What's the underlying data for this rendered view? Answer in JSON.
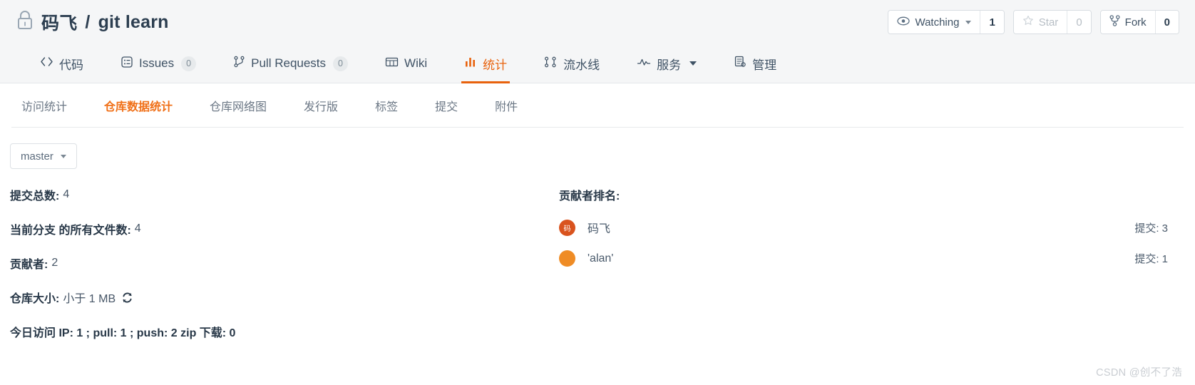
{
  "header": {
    "lock_icon": "lock-icon",
    "owner": "码飞",
    "separator": "/",
    "repo_name": "git learn",
    "actions": {
      "watch": {
        "icon": "eye-icon",
        "label": "Watching",
        "count": "1"
      },
      "star": {
        "icon": "star-icon",
        "label": "Star",
        "count": "0"
      },
      "fork": {
        "icon": "fork-icon",
        "label": "Fork",
        "count": "0"
      }
    }
  },
  "main_nav": [
    {
      "icon": "code-icon",
      "label": "代码",
      "badge": null,
      "active": false,
      "caret": false
    },
    {
      "icon": "issues-icon",
      "label": "Issues",
      "badge": "0",
      "active": false,
      "caret": false
    },
    {
      "icon": "pull-request-icon",
      "label": "Pull Requests",
      "badge": "0",
      "active": false,
      "caret": false
    },
    {
      "icon": "wiki-icon",
      "label": "Wiki",
      "badge": null,
      "active": false,
      "caret": false
    },
    {
      "icon": "chart-icon",
      "label": "统计",
      "badge": null,
      "active": true,
      "caret": false
    },
    {
      "icon": "pipeline-icon",
      "label": "流水线",
      "badge": null,
      "active": false,
      "caret": false
    },
    {
      "icon": "service-icon",
      "label": "服务",
      "badge": null,
      "active": false,
      "caret": true
    },
    {
      "icon": "manage-icon",
      "label": "管理",
      "badge": null,
      "active": false,
      "caret": false
    }
  ],
  "sub_nav": [
    {
      "label": "访问统计",
      "active": false
    },
    {
      "label": "仓库数据统计",
      "active": true
    },
    {
      "label": "仓库网络图",
      "active": false
    },
    {
      "label": "发行版",
      "active": false
    },
    {
      "label": "标签",
      "active": false
    },
    {
      "label": "提交",
      "active": false
    },
    {
      "label": "附件",
      "active": false
    }
  ],
  "branch": {
    "label": "master",
    "icon": "chevron-down-icon"
  },
  "stats": [
    {
      "label": "提交总数:",
      "value": "4",
      "bold_all": false,
      "sync": false
    },
    {
      "label": "当前分支 的所有文件数:",
      "value": "4",
      "bold_all": false,
      "sync": false
    },
    {
      "label": "贡献者:",
      "value": "2",
      "bold_all": false,
      "sync": false
    },
    {
      "label": "仓库大小:",
      "value": "小于 1 MB",
      "bold_all": false,
      "sync": true
    },
    {
      "label": "今日访问 IP: 1 ; pull: 1 ; push: 2 zip 下载: 0",
      "value": "",
      "bold_all": true,
      "sync": false
    }
  ],
  "contributors": {
    "title": "贡献者排名:",
    "items": [
      {
        "avatar_text": "码",
        "avatar_color": "#d9531e",
        "name": "码飞",
        "commits": "提交: 3"
      },
      {
        "avatar_text": "",
        "avatar_color": "#ef8c25",
        "name": "'alan'",
        "commits": "提交: 1"
      }
    ]
  },
  "watermark": "CSDN @创不了浩",
  "colors": {
    "accent": "#e8620d",
    "sub_accent": "#f07018",
    "text_dark": "#273747",
    "text_muted": "#6b7785",
    "header_bg": "#f5f6f7"
  }
}
